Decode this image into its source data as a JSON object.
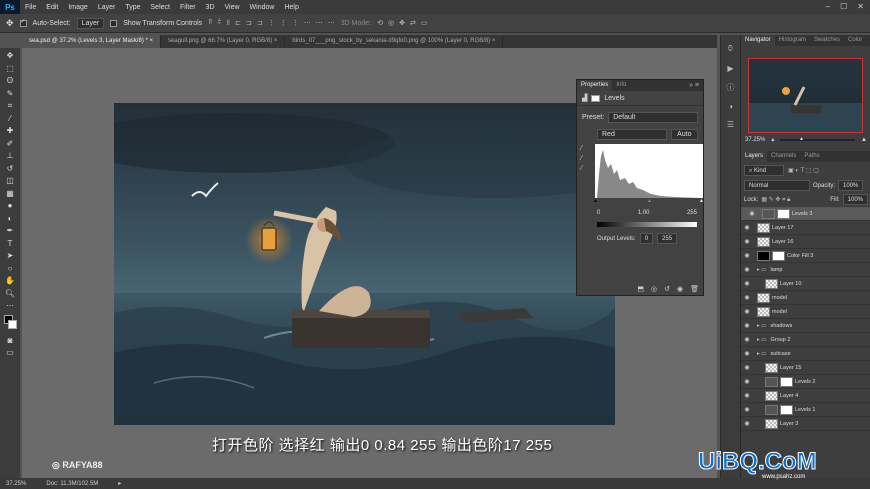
{
  "app": {
    "logo": "Ps"
  },
  "menu": [
    "File",
    "Edit",
    "Image",
    "Layer",
    "Type",
    "Select",
    "Filter",
    "3D",
    "View",
    "Window",
    "Help"
  ],
  "window_controls": [
    "–",
    "☐",
    "✕"
  ],
  "options_bar": {
    "auto_select_label": "Auto-Select:",
    "auto_select_value": "Layer",
    "transform_label": "Show Transform Controls",
    "mode_3d": "3D Mode:"
  },
  "doc_tabs": [
    "sea.psd @ 37.2% (Levels 3, Layer Mask/8) *",
    "seagull.png @ 66.7% (Layer 0, RGB/8)",
    "birds_07___png_stock_by_sekania-d9qfo0.png @ 100% (Layer 0, RGB/8)"
  ],
  "tools": [
    "move",
    "marquee",
    "lasso",
    "quick-select",
    "crop",
    "eyedropper",
    "heal",
    "brush",
    "stamp",
    "history-brush",
    "eraser",
    "gradient",
    "blur",
    "dodge",
    "pen",
    "type",
    "path-select",
    "shape",
    "hand",
    "zoom",
    "more",
    "colors",
    "quickmask",
    "screenmode"
  ],
  "status": {
    "zoom": "37.25%",
    "doc": "Doc: 11.3M/102.5M"
  },
  "navigator": {
    "tabs": [
      "Navigator",
      "Histogram",
      "Swatches",
      "Color"
    ],
    "zoom": "37.25%"
  },
  "properties": {
    "tabs": [
      "Properties",
      "Info"
    ],
    "type_label": "Levels",
    "preset_label": "Preset:",
    "preset_value": "Default",
    "channel_value": "Red",
    "auto_label": "Auto",
    "input_levels": [
      "0",
      "1.00",
      "255"
    ],
    "output_label": "Output Levels:",
    "output_levels": [
      "0",
      "255"
    ]
  },
  "layers_panel": {
    "tabs": [
      "Layers",
      "Channels",
      "Paths"
    ],
    "kind": "Kind",
    "blend": "Normal",
    "opacity_label": "Opacity:",
    "opacity": "100%",
    "lock_label": "Lock:",
    "fill_label": "Fill:",
    "fill": "100%",
    "layers": [
      {
        "name": "Levels 3",
        "kind": "adjust",
        "selected": true,
        "indent": 0
      },
      {
        "name": "Layer 17",
        "kind": "pixel",
        "indent": 0
      },
      {
        "name": "Layer 16",
        "kind": "pixel",
        "indent": 0
      },
      {
        "name": "Color Fill 3",
        "kind": "fill",
        "indent": 0
      },
      {
        "name": "lamp",
        "kind": "group",
        "indent": 0
      },
      {
        "name": "Layer 10",
        "kind": "pixel",
        "indent": 1
      },
      {
        "name": "model",
        "kind": "pixel",
        "indent": 0
      },
      {
        "name": "model",
        "kind": "pixel",
        "indent": 0
      },
      {
        "name": "shadows",
        "kind": "group",
        "indent": 0
      },
      {
        "name": "Group 2",
        "kind": "group",
        "indent": 0
      },
      {
        "name": "suitcase",
        "kind": "group",
        "indent": 0
      },
      {
        "name": "Layer 15",
        "kind": "pixel",
        "indent": 1
      },
      {
        "name": "Levels 2",
        "kind": "adjust",
        "indent": 1
      },
      {
        "name": "Layer 4",
        "kind": "pixel",
        "indent": 1
      },
      {
        "name": "Levels 1",
        "kind": "adjust",
        "indent": 1
      },
      {
        "name": "Layer 3",
        "kind": "pixel",
        "indent": 1
      }
    ]
  },
  "subtitle": "打开色阶  选择红  输出0  0.84  255  输出色阶17  255",
  "watermark_left": "RAFYA88",
  "watermark_right": "UiBQ.CoM",
  "watermark_right_sub": "www.psahz.com"
}
